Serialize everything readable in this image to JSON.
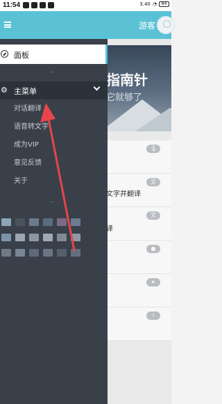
{
  "status_bar": {
    "time": "11:54",
    "network_speed": "3.40",
    "network_unit": "KB/s",
    "battery": "84"
  },
  "header": {
    "guest_label": "游客",
    "menu_icon": "hamburger-icon",
    "avatar_icon": "user-avatar-icon"
  },
  "drawer": {
    "dashboard": {
      "label": "面板",
      "icon": "compass-icon"
    },
    "main_menu": {
      "label": "主菜单",
      "icon": "gear-icon",
      "chevron": "chevron-down-icon"
    },
    "submenu": [
      {
        "label": "对话翻译"
      },
      {
        "label": "语音转文字"
      },
      {
        "label": "成为VIP"
      },
      {
        "label": "意见反馈"
      },
      {
        "label": "关于"
      }
    ]
  },
  "main": {
    "banner_title": "指南针",
    "banner_subtitle": "它就够了",
    "features": [
      {
        "text": "",
        "icon": "microphone-icon"
      },
      {
        "text": "文字并翻译",
        "icon": "translate-icon"
      },
      {
        "text": "译",
        "icon": "translate-icon"
      },
      {
        "text": "",
        "icon": "person-icon"
      },
      {
        "text": "",
        "icon": "send-icon"
      },
      {
        "text": "",
        "icon": "info-icon"
      }
    ]
  },
  "colors": {
    "header": "#5bc2d6",
    "drawer": "#39404a",
    "drawer_header": "#2c3239",
    "arrow": "#e8454a"
  }
}
